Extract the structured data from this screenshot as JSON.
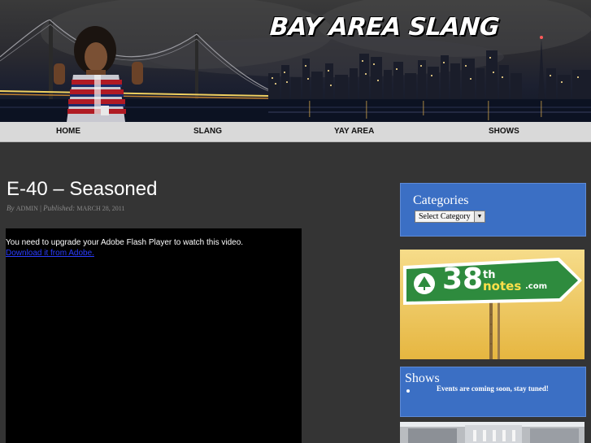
{
  "site": {
    "title": "BAY AREA SLANG"
  },
  "nav": {
    "items": [
      {
        "label": "HOME"
      },
      {
        "label": "SLANG"
      },
      {
        "label": "YAY AREA"
      },
      {
        "label": "SHOWS"
      }
    ]
  },
  "post": {
    "title": "E-40 – Seasoned",
    "meta": {
      "by": "By",
      "author": "ADMIN",
      "separator": "|",
      "published": "Published:",
      "date": "MARCH 28, 2011"
    },
    "video": {
      "message": "You need to upgrade your Adobe Flash Player to watch this video.",
      "download_link": "Download it from Adobe."
    }
  },
  "sidebar": {
    "categories": {
      "title": "Categories",
      "select_value": "Select Category"
    },
    "ad": {
      "text_38": "38",
      "text_th": "th",
      "text_notes": "notes",
      "text_com": ".com"
    },
    "shows": {
      "title": "Shows",
      "items": [
        "Events are coming soon, stay tuned!"
      ]
    }
  },
  "colors": {
    "background": "#343434",
    "nav_bg": "#d9d9d9",
    "widget_blue": "#3b6fc4",
    "link_blue": "#2b3dff",
    "sign_green": "#2e8b3e"
  }
}
